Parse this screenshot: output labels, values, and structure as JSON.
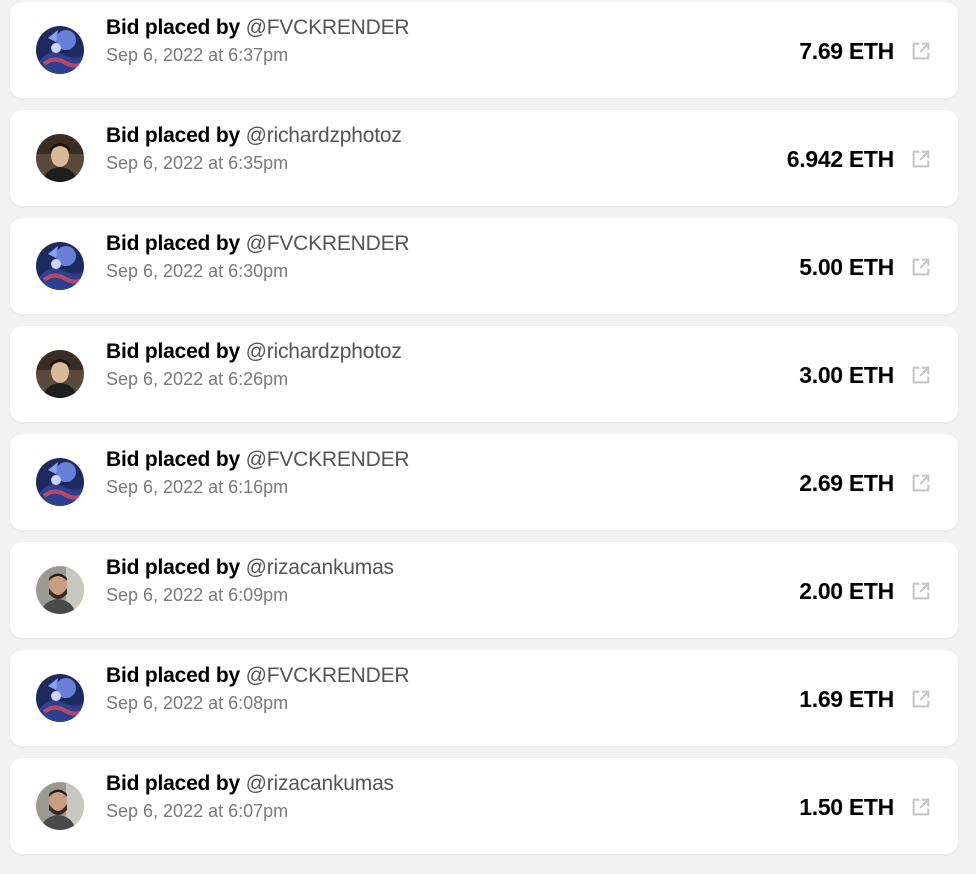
{
  "bids": [
    {
      "label": "Bid placed by",
      "user": "@FVCKRENDER",
      "time": "Sep 6, 2022 at 6:37pm",
      "amount": "7.69 ETH",
      "avatar": "fvckrender-avatar"
    },
    {
      "label": "Bid placed by",
      "user": "@richardzphotoz",
      "time": "Sep 6, 2022 at 6:35pm",
      "amount": "6.942 ETH",
      "avatar": "richardzphotoz-avatar"
    },
    {
      "label": "Bid placed by",
      "user": "@FVCKRENDER",
      "time": "Sep 6, 2022 at 6:30pm",
      "amount": "5.00 ETH",
      "avatar": "fvckrender-avatar"
    },
    {
      "label": "Bid placed by",
      "user": "@richardzphotoz",
      "time": "Sep 6, 2022 at 6:26pm",
      "amount": "3.00 ETH",
      "avatar": "richardzphotoz-avatar"
    },
    {
      "label": "Bid placed by",
      "user": "@FVCKRENDER",
      "time": "Sep 6, 2022 at 6:16pm",
      "amount": "2.69 ETH",
      "avatar": "fvckrender-avatar"
    },
    {
      "label": "Bid placed by",
      "user": "@rizacankumas",
      "time": "Sep 6, 2022 at 6:09pm",
      "amount": "2.00 ETH",
      "avatar": "rizacankumas-avatar"
    },
    {
      "label": "Bid placed by",
      "user": "@FVCKRENDER",
      "time": "Sep 6, 2022 at 6:08pm",
      "amount": "1.69 ETH",
      "avatar": "fvckrender-avatar"
    },
    {
      "label": "Bid placed by",
      "user": "@rizacankumas",
      "time": "Sep 6, 2022 at 6:07pm",
      "amount": "1.50 ETH",
      "avatar": "rizacankumas-avatar"
    }
  ],
  "icons": {
    "external_link": "external-link-icon"
  },
  "colors": {
    "card": "#ffffff",
    "background": "#f2f2f2",
    "username": "#555555",
    "timestamp": "#7a7a7a",
    "icon": "#c4c4c4"
  }
}
